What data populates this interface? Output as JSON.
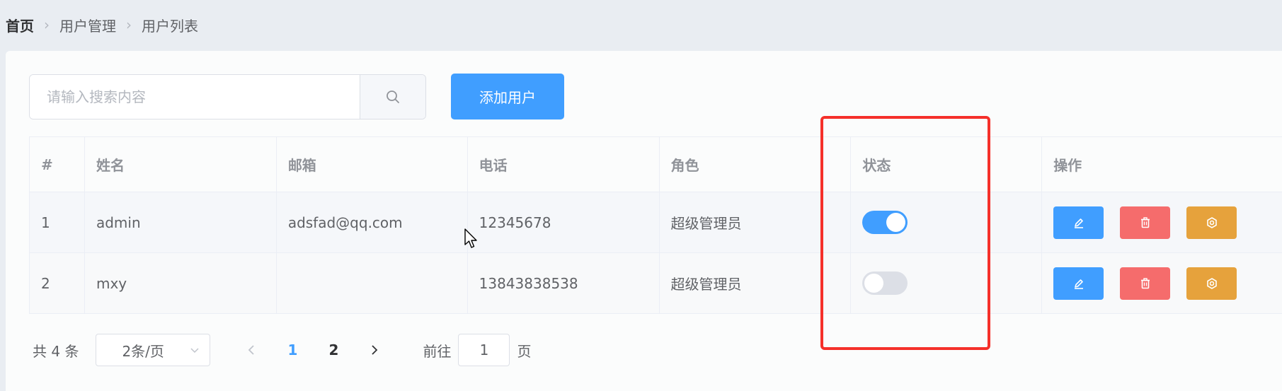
{
  "breadcrumb": {
    "items": [
      "首页",
      "用户管理",
      "用户列表"
    ]
  },
  "search": {
    "placeholder": "请输入搜索内容",
    "value": ""
  },
  "add_button_label": "添加用户",
  "table": {
    "headers": [
      "#",
      "姓名",
      "邮箱",
      "电话",
      "角色",
      "状态",
      "操作"
    ],
    "rows": [
      {
        "index": "1",
        "name": "admin",
        "email": "adsfad@qq.com",
        "phone": "12345678",
        "role": "超级管理员",
        "status_on": true
      },
      {
        "index": "2",
        "name": "mxy",
        "email": "",
        "phone": "13843838538",
        "role": "超级管理员",
        "status_on": false
      }
    ]
  },
  "pagination": {
    "total_text": "共 4 条",
    "page_size": "2条/页",
    "pages": [
      "1",
      "2"
    ],
    "current_page": "1",
    "jump_prefix": "前往",
    "jump_value": "1",
    "jump_suffix": "页"
  },
  "colors": {
    "primary": "#409eff",
    "danger": "#f56c6c",
    "warning": "#e6a23c",
    "highlight_box": "#f5302a"
  }
}
